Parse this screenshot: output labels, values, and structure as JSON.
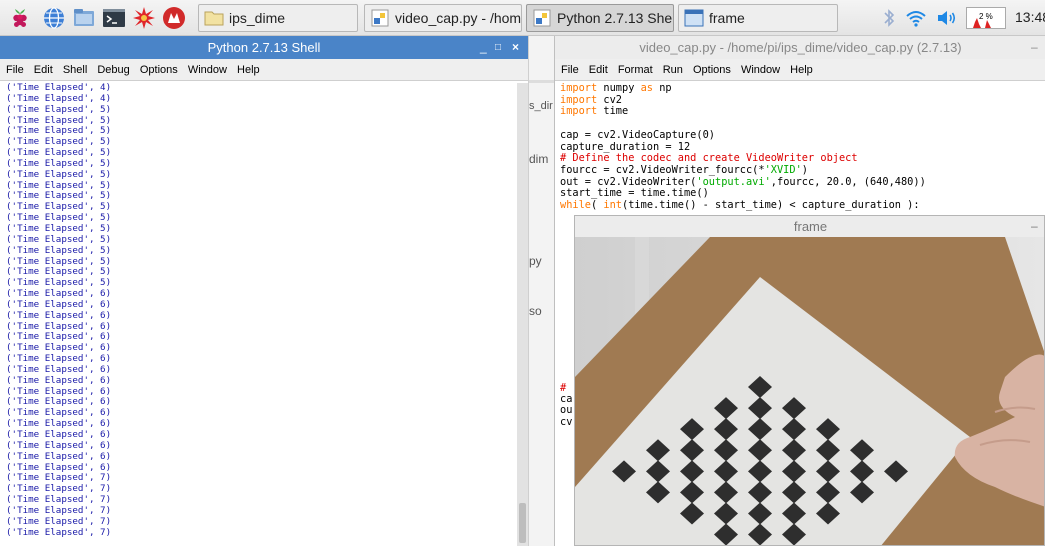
{
  "taskbar": {
    "launchers": [
      "raspberry-menu-icon",
      "web-browser-icon",
      "file-manager-icon",
      "terminal-icon",
      "mathematica-icon",
      "wolfram-icon"
    ],
    "tasks": [
      {
        "label": "ips_dime",
        "icon": "folder-icon",
        "active": false
      },
      {
        "label": "video_cap.py - /home...",
        "icon": "python-icon",
        "active": false
      },
      {
        "label": "Python 2.7.13 Shell",
        "icon": "python-icon",
        "active": true
      },
      {
        "label": "frame",
        "icon": "window-icon",
        "active": false
      }
    ],
    "cpu_label": "2 %",
    "clock": "13:48"
  },
  "shell": {
    "title": "Python 2.7.13 Shell",
    "controls": [
      "_",
      "□",
      "×"
    ],
    "menu": [
      "File",
      "Edit",
      "Shell",
      "Debug",
      "Options",
      "Window",
      "Help"
    ],
    "lines": [
      "('Time Elapsed', 4)",
      "('Time Elapsed', 4)",
      "('Time Elapsed', 5)",
      "('Time Elapsed', 5)",
      "('Time Elapsed', 5)",
      "('Time Elapsed', 5)",
      "('Time Elapsed', 5)",
      "('Time Elapsed', 5)",
      "('Time Elapsed', 5)",
      "('Time Elapsed', 5)",
      "('Time Elapsed', 5)",
      "('Time Elapsed', 5)",
      "('Time Elapsed', 5)",
      "('Time Elapsed', 5)",
      "('Time Elapsed', 5)",
      "('Time Elapsed', 5)",
      "('Time Elapsed', 5)",
      "('Time Elapsed', 5)",
      "('Time Elapsed', 5)",
      "('Time Elapsed', 6)",
      "('Time Elapsed', 6)",
      "('Time Elapsed', 6)",
      "('Time Elapsed', 6)",
      "('Time Elapsed', 6)",
      "('Time Elapsed', 6)",
      "('Time Elapsed', 6)",
      "('Time Elapsed', 6)",
      "('Time Elapsed', 6)",
      "('Time Elapsed', 6)",
      "('Time Elapsed', 6)",
      "('Time Elapsed', 6)",
      "('Time Elapsed', 6)",
      "('Time Elapsed', 6)",
      "('Time Elapsed', 6)",
      "('Time Elapsed', 6)",
      "('Time Elapsed', 6)",
      "('Time Elapsed', 7)",
      "('Time Elapsed', 7)",
      "('Time Elapsed', 7)",
      "('Time Elapsed', 7)",
      "('Time Elapsed', 7)",
      "('Time Elapsed', 7)"
    ]
  },
  "background_window": {
    "snippets": [
      "s_dir",
      "dim",
      "py",
      "so"
    ]
  },
  "editor": {
    "title": "video_cap.py - /home/pi/ips_dime/video_cap.py (2.7.13)",
    "controls": [
      "–"
    ],
    "menu": [
      "File",
      "Edit",
      "Format",
      "Run",
      "Options",
      "Window",
      "Help"
    ],
    "code": [
      [
        {
          "t": "import",
          "c": "kw"
        },
        {
          "t": " numpy ",
          "c": ""
        },
        {
          "t": "as",
          "c": "kw"
        },
        {
          "t": " np",
          "c": ""
        }
      ],
      [
        {
          "t": "import",
          "c": "kw"
        },
        {
          "t": " cv2",
          "c": ""
        }
      ],
      [
        {
          "t": "import",
          "c": "kw"
        },
        {
          "t": " time",
          "c": ""
        }
      ],
      [
        {
          "t": "",
          "c": ""
        }
      ],
      [
        {
          "t": "cap = cv2.VideoCapture(0)",
          "c": ""
        }
      ],
      [
        {
          "t": "capture_duration = 12",
          "c": ""
        }
      ],
      [
        {
          "t": "# Define the codec and create VideoWriter object",
          "c": "cm"
        }
      ],
      [
        {
          "t": "fourcc = cv2.VideoWriter_fourcc(*",
          "c": ""
        },
        {
          "t": "'XVID'",
          "c": "str"
        },
        {
          "t": ")",
          "c": ""
        }
      ],
      [
        {
          "t": "out = cv2.VideoWriter(",
          "c": ""
        },
        {
          "t": "'output.avi'",
          "c": "str"
        },
        {
          "t": ",fourcc, 20.0, (640,480))",
          "c": ""
        }
      ],
      [
        {
          "t": "start_time = time.time()",
          "c": ""
        }
      ],
      [
        {
          "t": "while",
          "c": "kw"
        },
        {
          "t": "( ",
          "c": ""
        },
        {
          "t": "int",
          "c": "kw"
        },
        {
          "t": "(time.time() - start_time) < capture_duration ):",
          "c": ""
        }
      ]
    ],
    "partial_lines": [
      {
        "t": "#",
        "c": "cm"
      },
      {
        "t": "ca",
        "c": ""
      },
      {
        "t": "ou",
        "c": ""
      },
      {
        "t": "cv",
        "c": ""
      }
    ]
  },
  "frame": {
    "title": "frame",
    "controls": [
      "–"
    ]
  }
}
